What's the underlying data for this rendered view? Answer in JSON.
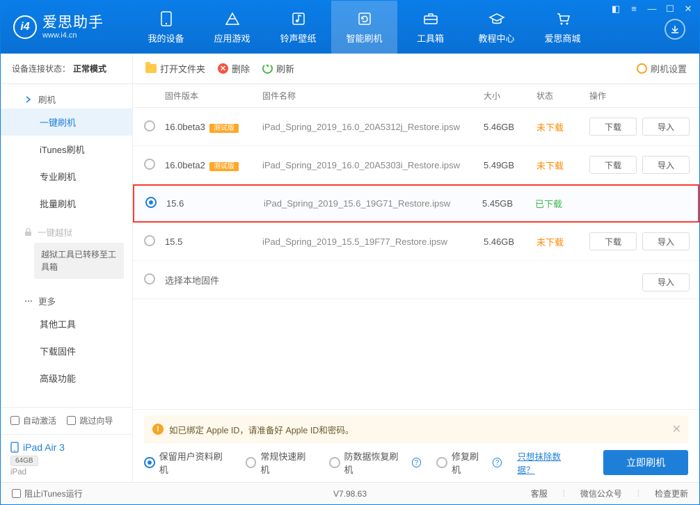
{
  "app": {
    "title": "爱思助手",
    "subtitle": "www.i4.cn"
  },
  "nav": {
    "items": [
      {
        "label": "我的设备"
      },
      {
        "label": "应用游戏"
      },
      {
        "label": "铃声壁纸"
      },
      {
        "label": "智能刷机"
      },
      {
        "label": "工具箱"
      },
      {
        "label": "教程中心"
      },
      {
        "label": "爱思商城"
      }
    ]
  },
  "conn": {
    "label": "设备连接状态：",
    "value": "正常模式"
  },
  "toolbar": {
    "open": "打开文件夹",
    "delete": "删除",
    "refresh": "刷新",
    "settings": "刷机设置"
  },
  "sidebar": {
    "groups": {
      "flash": "刷机",
      "jailbreak": "一键越狱",
      "more": "更多"
    },
    "items": {
      "oneKey": "一键刷机",
      "itunes": "iTunes刷机",
      "pro": "专业刷机",
      "batch": "批量刷机",
      "jbMsg": "越狱工具已转移至工具箱",
      "other": "其他工具",
      "download": "下载固件",
      "advanced": "高级功能"
    },
    "bottom": {
      "autoActivate": "自动激活",
      "skipGuide": "跳过向导"
    }
  },
  "device": {
    "name": "iPad Air 3",
    "storage": "64GB",
    "type": "iPad"
  },
  "table": {
    "headers": {
      "version": "固件版本",
      "name": "固件名称",
      "size": "大小",
      "status": "状态",
      "ops": "操作"
    },
    "ops": {
      "download": "下载",
      "import": "导入"
    },
    "localRow": "选择本地固件",
    "betaLabel": "测试版",
    "rows": [
      {
        "version": "16.0beta3",
        "beta": true,
        "name": "iPad_Spring_2019_16.0_20A5312j_Restore.ipsw",
        "size": "5.46GB",
        "status": "未下载",
        "statusClass": "orange",
        "selected": false,
        "highlighted": false,
        "ops": true
      },
      {
        "version": "16.0beta2",
        "beta": true,
        "name": "iPad_Spring_2019_16.0_20A5303i_Restore.ipsw",
        "size": "5.49GB",
        "status": "未下载",
        "statusClass": "orange",
        "selected": false,
        "highlighted": false,
        "ops": true
      },
      {
        "version": "15.6",
        "beta": false,
        "name": "iPad_Spring_2019_15.6_19G71_Restore.ipsw",
        "size": "5.45GB",
        "status": "已下载",
        "statusClass": "green",
        "selected": true,
        "highlighted": true,
        "ops": false
      },
      {
        "version": "15.5",
        "beta": false,
        "name": "iPad_Spring_2019_15.5_19F77_Restore.ipsw",
        "size": "5.46GB",
        "status": "未下载",
        "statusClass": "orange",
        "selected": false,
        "highlighted": false,
        "ops": true
      }
    ]
  },
  "alert": "如已绑定 Apple ID，请准备好 Apple ID和密码。",
  "flashOpts": {
    "keepData": "保留用户资料刷机",
    "normal": "常规快速刷机",
    "recover": "防数据恢复刷机",
    "repair": "修复刷机",
    "eraseLink": "只想抹除数据？",
    "flashBtn": "立即刷机"
  },
  "footer": {
    "blockItunes": "阻止iTunes运行",
    "version": "V7.98.63",
    "links": {
      "support": "客服",
      "wechat": "微信公众号",
      "update": "检查更新"
    }
  }
}
